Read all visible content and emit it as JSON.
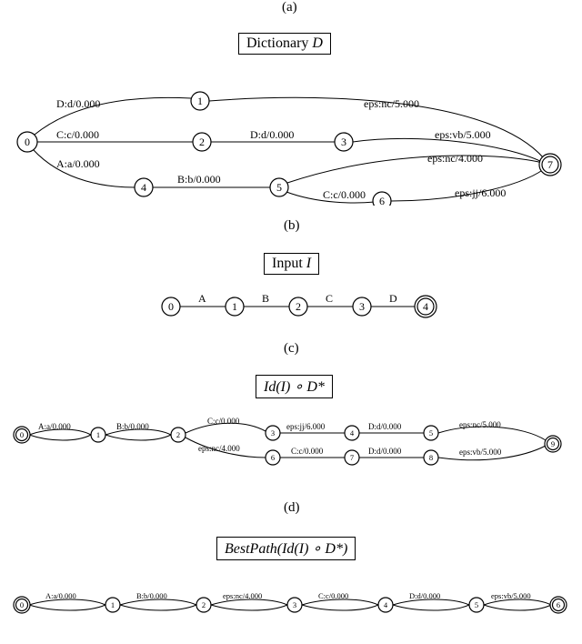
{
  "figA": {
    "label": "(a)"
  },
  "titleB": {
    "prefix": "Dictionary ",
    "var": "D"
  },
  "graphB": {
    "nodes": {
      "n0": "0",
      "n1": "1",
      "n2": "2",
      "n3": "3",
      "n4": "4",
      "n5": "5",
      "n6": "6",
      "n7": "7"
    },
    "edges": {
      "e01": "D:d/0.000",
      "e02": "C:c/0.000",
      "e04": "A:a/0.000",
      "e17": "eps:nc/5.000",
      "e23": "D:d/0.000",
      "e37": "eps:vb/5.000",
      "e45": "B:b/0.000",
      "e57": "eps:nc/4.000",
      "e56": "C:c/0.000",
      "e67": "eps:jj/6.000"
    }
  },
  "figB": {
    "label": "(b)"
  },
  "titleC": {
    "prefix": "Input ",
    "var": "I"
  },
  "graphC": {
    "nodes": {
      "n0": "0",
      "n1": "1",
      "n2": "2",
      "n3": "3",
      "n4": "4"
    },
    "edges": {
      "e01": "A",
      "e12": "B",
      "e23": "C",
      "e34": "D"
    }
  },
  "figC": {
    "label": "(c)"
  },
  "titleD": {
    "tex": "Id(I) ∘ D*"
  },
  "graphD": {
    "nodes": {
      "n0": "0",
      "n1": "1",
      "n2": "2",
      "n3": "3",
      "n4": "4",
      "n5": "5",
      "n6": "6",
      "n7": "7",
      "n8": "8",
      "n9": "9"
    },
    "edges": {
      "e01": "A:a/0.000",
      "e12": "B:b/0.000",
      "e23": "C:c/0.000",
      "e26": "eps:nc/4.000",
      "e34": "eps:jj/6.000",
      "e45": "D:d/0.000",
      "e67": "C:c/0.000",
      "e78": "D:d/0.000",
      "e59": "eps:nc/5.000",
      "e89": "eps:vb/5.000"
    }
  },
  "figD": {
    "label": "(d)"
  },
  "titleE": {
    "tex": "BestPath(Id(I) ∘ D*)"
  },
  "graphE": {
    "nodes": {
      "n0": "0",
      "n1": "1",
      "n2": "2",
      "n3": "3",
      "n4": "4",
      "n5": "5",
      "n6": "6"
    },
    "edges": {
      "e01": "A:a/0.000",
      "e12": "B:b/0.000",
      "e23": "eps:nc/4.000",
      "e34": "C:c/0.000",
      "e45": "D:d/0.000",
      "e56": "eps:vb/5.000"
    }
  }
}
